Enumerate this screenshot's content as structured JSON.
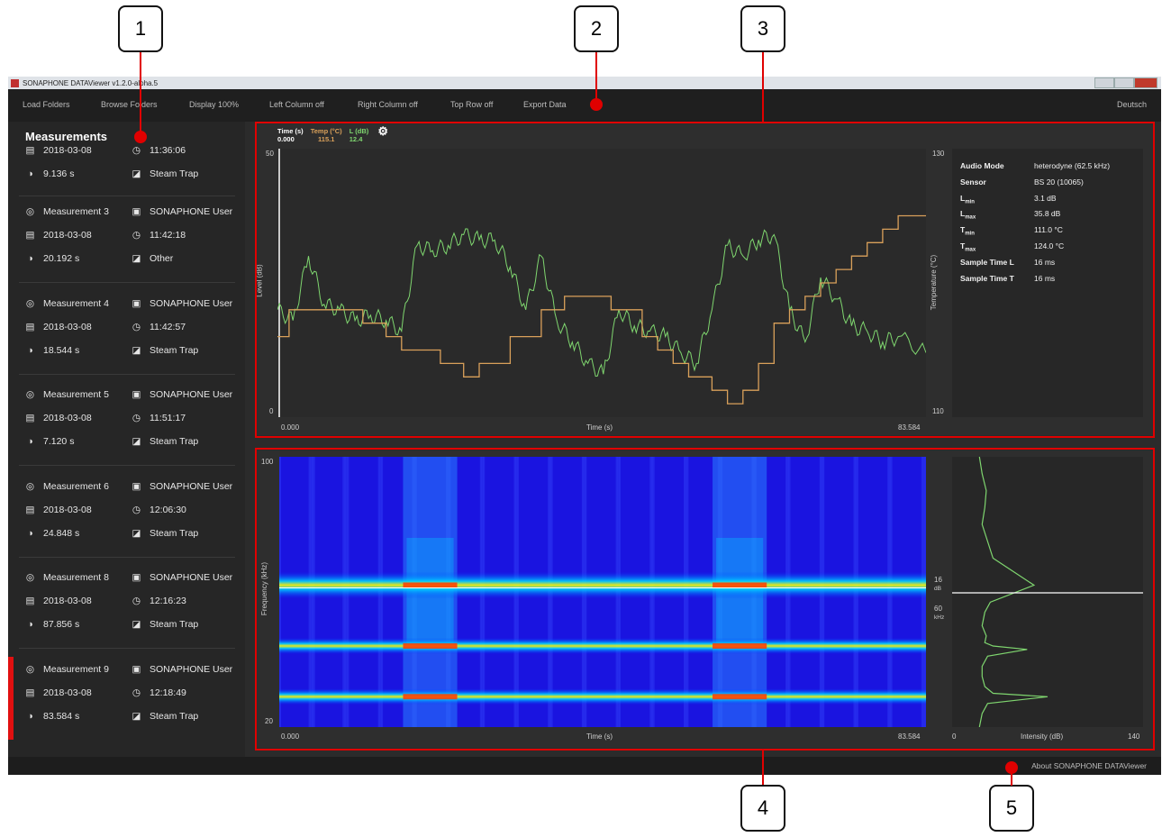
{
  "callouts": [
    "1",
    "2",
    "3",
    "4",
    "5"
  ],
  "titlebar": {
    "title": "SONAPHONE DATAViewer v1.2.0-alpha.5"
  },
  "menu": {
    "load_folders": "Load Folders",
    "browse_folders": "Browse Folders",
    "display": "Display 100%",
    "left_column": "Left Column off",
    "right_column": "Right Column off",
    "top_row": "Top Row off",
    "export": "Export Data",
    "language": "Deutsch"
  },
  "sidebar": {
    "title": "Measurements",
    "partial": {
      "date": "2018-03-08",
      "time": "11:36:06",
      "duration": "9.136 s",
      "type": "Steam Trap"
    },
    "items": [
      {
        "name": "Measurement 3",
        "user": "SONAPHONE User",
        "date": "2018-03-08",
        "time": "11:42:18",
        "duration": "20.192 s",
        "type": "Other"
      },
      {
        "name": "Measurement 4",
        "user": "SONAPHONE User",
        "date": "2018-03-08",
        "time": "11:42:57",
        "duration": "18.544 s",
        "type": "Steam Trap"
      },
      {
        "name": "Measurement 5",
        "user": "SONAPHONE User",
        "date": "2018-03-08",
        "time": "11:51:17",
        "duration": "7.120 s",
        "type": "Steam Trap"
      },
      {
        "name": "Measurement 6",
        "user": "SONAPHONE User",
        "date": "2018-03-08",
        "time": "12:06:30",
        "duration": "24.848 s",
        "type": "Steam Trap"
      },
      {
        "name": "Measurement 8",
        "user": "SONAPHONE User",
        "date": "2018-03-08",
        "time": "12:16:23",
        "duration": "87.856 s",
        "type": "Steam Trap"
      },
      {
        "name": "Measurement 9",
        "user": "SONAPHONE User",
        "date": "2018-03-08",
        "time": "12:18:49",
        "duration": "83.584 s",
        "type": "Steam Trap"
      }
    ],
    "selected_index": 5
  },
  "readout": {
    "time_label": "Time (s)",
    "time_value": "0.000",
    "temp_label": "Temp (°C)",
    "temp_value": "115.1",
    "level_label": "L (dB)",
    "level_value": "12.4"
  },
  "level_chart": {
    "ylabel": "Level (dB)",
    "y2label": "Temperature (°C)",
    "xlabel": "Time (s)",
    "ymin": "0",
    "ymax": "50",
    "y2min": "110",
    "y2max": "130",
    "xmin": "0.000",
    "xmax": "83.584"
  },
  "info": {
    "rows": [
      {
        "k": "Audio Mode",
        "v": "heterodyne (62.5 kHz)"
      },
      {
        "k": "Sensor",
        "v": "BS 20 (10065)"
      },
      {
        "k": "L",
        "sub": "min",
        "v": "3.1 dB"
      },
      {
        "k": "L",
        "sub": "max",
        "v": "35.8 dB"
      },
      {
        "k": "T",
        "sub": "min",
        "v": "111.0 °C"
      },
      {
        "k": "T",
        "sub": "max",
        "v": "124.0 °C"
      },
      {
        "k": "Sample Time L",
        "v": "16 ms"
      },
      {
        "k": "Sample Time T",
        "v": "16 ms"
      }
    ]
  },
  "spectrogram": {
    "ylabel": "Frequency (kHz)",
    "xlabel": "Time (s)",
    "ymin": "20",
    "ymax": "100",
    "xmin": "0.000",
    "xmax": "83.584",
    "cursor_db": "16",
    "cursor_db_unit": "dB",
    "cursor_khz": "60",
    "cursor_khz_unit": "kHz"
  },
  "intensity": {
    "xlabel": "Intensity (dB)",
    "xmin": "0",
    "xmax": "140"
  },
  "status": {
    "about": "About SONAPHONE DATAViewer"
  },
  "colors": {
    "level": "#7fd66f",
    "temperature": "#d9a05a",
    "highlight": "#e00000"
  },
  "chart_data": [
    {
      "type": "line",
      "title": "",
      "xlabel": "Time (s)",
      "ylabel": "Level (dB)",
      "xlim": [
        0,
        83.584
      ],
      "ylim": [
        0,
        50
      ],
      "y2lim": [
        110,
        130
      ],
      "series": [
        {
          "name": "L (dB)",
          "axis": "left",
          "x": [
            0,
            2,
            4,
            6,
            8,
            10,
            12,
            14,
            16,
            18,
            20,
            22,
            24,
            26,
            28,
            30,
            32,
            34,
            36,
            38,
            40,
            42,
            44,
            46,
            48,
            50,
            52,
            54,
            56,
            58,
            60,
            62,
            64,
            66,
            68,
            70,
            72,
            74,
            76,
            78,
            80,
            83.584
          ],
          "y": [
            20,
            18,
            30,
            21,
            20,
            18,
            19,
            18,
            16,
            32,
            31,
            32,
            34,
            33,
            33,
            28,
            20,
            30,
            18,
            14,
            10,
            8,
            20,
            17,
            16,
            15,
            12,
            10,
            20,
            32,
            30,
            33,
            34,
            20,
            14,
            26,
            22,
            17,
            16,
            14,
            15,
            12
          ]
        },
        {
          "name": "Temp (°C)",
          "axis": "right",
          "x": [
            0,
            1.5,
            1.5,
            11,
            11,
            14,
            14,
            16,
            16,
            21,
            21,
            24,
            24,
            26,
            26,
            30,
            30,
            34,
            34,
            37,
            37,
            43,
            43,
            47,
            47,
            49,
            49,
            51,
            51,
            53,
            53,
            56,
            56,
            58,
            58,
            60,
            60,
            62,
            62,
            64,
            64,
            66,
            66,
            68,
            68,
            70,
            70,
            72,
            72,
            74,
            74,
            76,
            76,
            78,
            78,
            80,
            80,
            83.584
          ],
          "y": [
            116,
            116,
            118,
            118,
            117,
            117,
            116,
            116,
            115,
            115,
            114,
            114,
            113,
            113,
            114,
            114,
            116,
            116,
            118,
            118,
            119,
            119,
            118,
            118,
            116,
            116,
            115,
            115,
            114,
            114,
            113,
            113,
            112,
            112,
            111,
            111,
            112,
            112,
            114,
            114,
            117,
            117,
            118,
            118,
            119,
            119,
            120,
            120,
            121,
            121,
            122,
            122,
            123,
            123,
            124,
            124,
            125,
            125
          ]
        }
      ]
    },
    {
      "type": "heatmap",
      "title": "",
      "xlabel": "Time (s)",
      "ylabel": "Frequency (kHz)",
      "xlim": [
        0,
        83.584
      ],
      "ylim": [
        20,
        100
      ],
      "bands_khz": [
        62,
        44,
        29
      ],
      "bursts_s": [
        [
          16,
          23
        ],
        [
          56,
          63
        ]
      ]
    },
    {
      "type": "line",
      "title": "",
      "xlabel": "Intensity (dB)",
      "ylabel": "",
      "xlim": [
        0,
        140
      ],
      "series": [
        {
          "name": "",
          "x": [
            20,
            22,
            25,
            24,
            22,
            30,
            60,
            28,
            24,
            22,
            25,
            24,
            30,
            55,
            26,
            22,
            22,
            24,
            30,
            70,
            26,
            22,
            20
          ],
          "y": [
            100,
            95,
            90,
            85,
            80,
            70,
            62,
            57,
            54,
            50,
            47,
            45,
            44,
            43,
            41,
            38,
            35,
            32,
            30,
            29,
            27,
            24,
            20
          ]
        }
      ]
    }
  ]
}
